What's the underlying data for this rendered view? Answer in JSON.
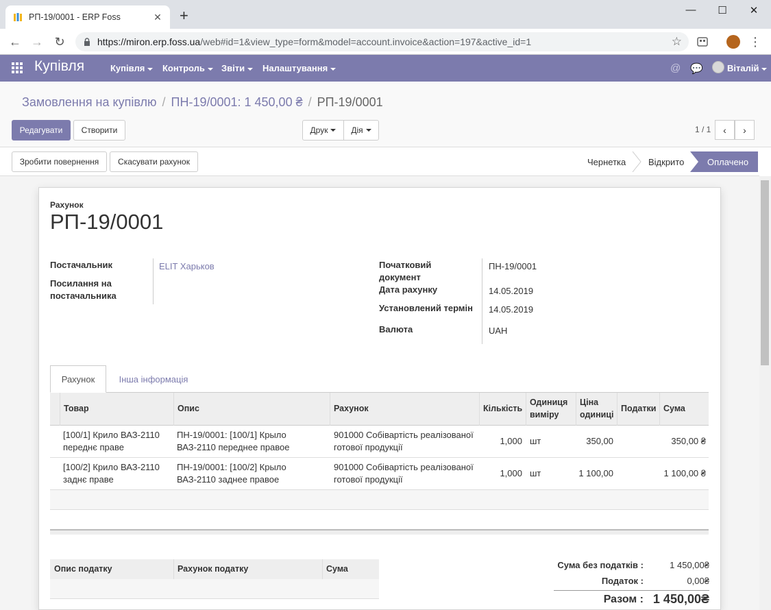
{
  "browser": {
    "tab_title": "РП-19/0001 - ERP Foss",
    "url_host": "https://miron.erp.foss.ua",
    "url_path": "/web#id=1&view_type=form&model=account.invoice&action=197&active_id=1"
  },
  "nav": {
    "app_title": "Купівля",
    "menus": [
      "Купівля",
      "Контроль",
      "Звіти",
      "Налаштування"
    ],
    "user": "Віталій"
  },
  "breadcrumb": {
    "item1": "Замовлення на купівлю",
    "item2": "ПН-19/0001: 1 450,00 ₴",
    "current": "РП-19/0001",
    "sep": "/"
  },
  "buttons": {
    "edit": "Редагувати",
    "create": "Створити",
    "print": "Друк",
    "action": "Дія",
    "refund": "Зробити повернення",
    "cancel": "Скасувати рахунок"
  },
  "pager": {
    "value": "1 / 1"
  },
  "status": {
    "draft": "Чернетка",
    "open": "Відкрито",
    "paid": "Оплачено"
  },
  "invoice": {
    "type_label": "Рахунок",
    "number": "РП-19/0001",
    "vendor_label": "Постачальник",
    "vendor": "ELIT Харьков",
    "vendor_ref_label": "Посилання на постачальника",
    "source_label": "Початковий документ",
    "source": "ПН-19/0001",
    "date_label": "Дата рахунку",
    "date": "14.05.2019",
    "due_label": "Установлений термін",
    "due": "14.05.2019",
    "currency_label": "Валюта",
    "currency": "UAH"
  },
  "tabs": {
    "invoice": "Рахунок",
    "other": "Інша інформація"
  },
  "lines": {
    "headers": {
      "product": "Товар",
      "description": "Опис",
      "account": "Рахунок",
      "qty": "Кількість",
      "uom": "Одиниця виміру",
      "price": "Ціна одиниці",
      "taxes": "Податки",
      "amount": "Сума"
    },
    "rows": [
      {
        "product": "[100/1] Крило ВАЗ-2110 переднє праве",
        "description": "ПН-19/0001: [100/1] Крыло ВАЗ-2110 переднее правое",
        "account": "901000 Собівартість реалізованої готової продукції",
        "qty": "1,000",
        "uom": "шт",
        "price": "350,00",
        "taxes": "",
        "amount": "350,00 ₴"
      },
      {
        "product": "[100/2] Крило ВАЗ-2110 заднє праве",
        "description": "ПН-19/0001: [100/2] Крыло ВАЗ-2110 заднее правое",
        "account": "901000 Собівартість реалізованої готової продукції",
        "qty": "1,000",
        "uom": "шт",
        "price": "1 100,00",
        "taxes": "",
        "amount": "1 100,00 ₴"
      }
    ]
  },
  "tax_table": {
    "h_desc": "Опис податку",
    "h_account": "Рахунок податку",
    "h_amount": "Сума"
  },
  "totals": {
    "untaxed_label": "Сума без податків :",
    "untaxed": "1 450,00₴",
    "tax_label": "Податок :",
    "tax": "0,00₴",
    "total_label": "Разом :",
    "total": "1 450,00₴"
  },
  "colors": {
    "brand": "#7c7bad"
  }
}
